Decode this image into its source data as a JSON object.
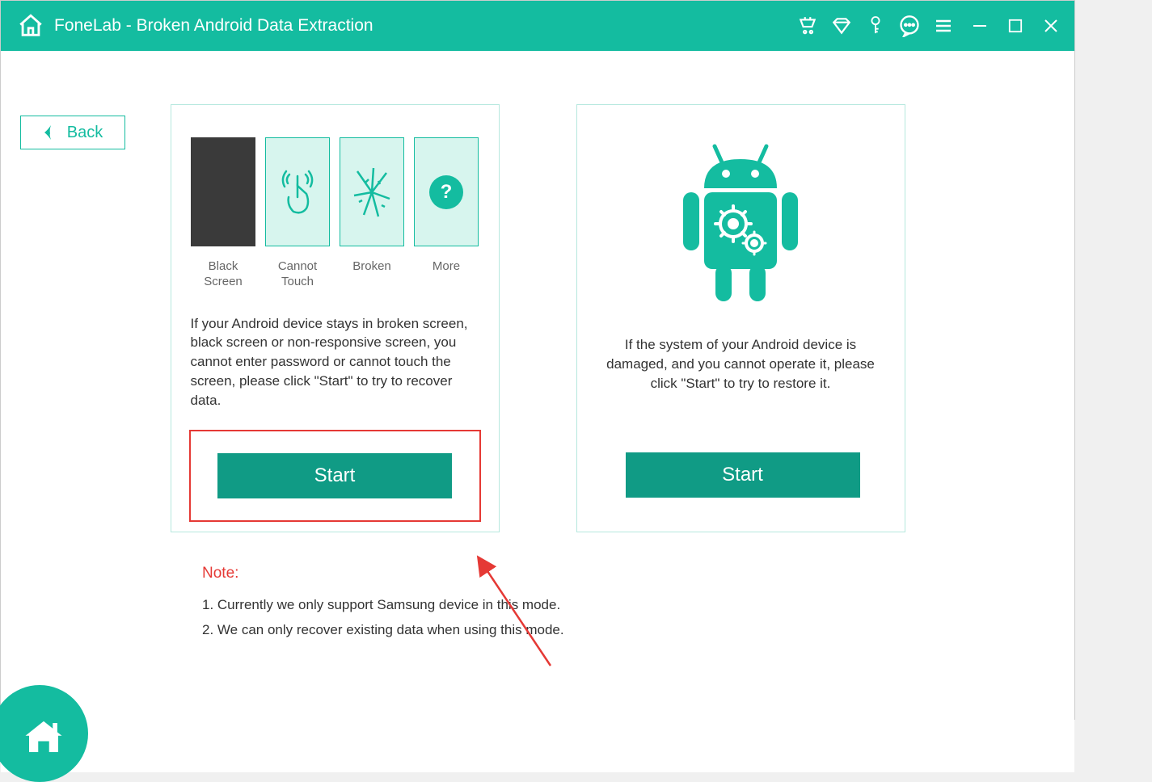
{
  "title": "FoneLab - Broken Android Data Extraction",
  "back_label": "Back",
  "options": {
    "black_screen": "Black\nScreen",
    "cannot_touch": "Cannot\nTouch",
    "broken": "Broken",
    "more": "More"
  },
  "left_desc": "If your Android device stays in broken screen, black screen or non-responsive screen, you cannot enter password or cannot touch the screen, please click \"Start\" to try to recover data.",
  "right_desc": "If the system of your Android device is damaged, and you cannot operate it, please click \"Start\" to try to restore it.",
  "start_label": "Start",
  "note_head": "Note:",
  "note1": "1. Currently we only support Samsung device in this mode.",
  "note2": "2. We can only recover existing data when using this mode."
}
